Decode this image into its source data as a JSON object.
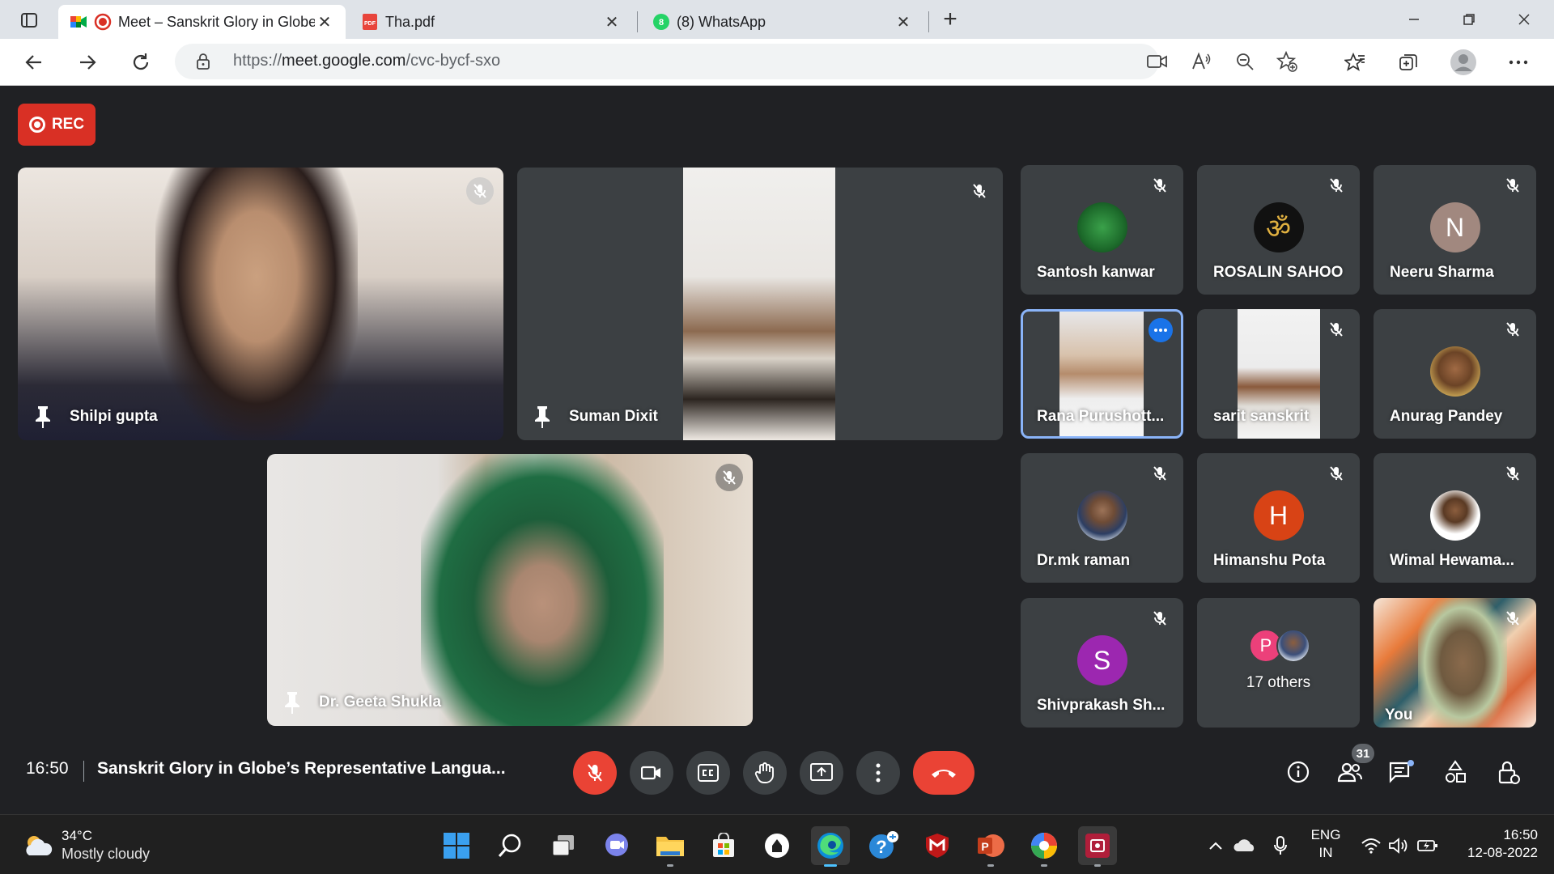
{
  "browser": {
    "tabs": [
      {
        "title": "Meet – Sanskrit Glory in Globe's Representative Languages",
        "active": true
      },
      {
        "title": "Tha.pdf",
        "active": false
      },
      {
        "title": "(8) WhatsApp",
        "active": false,
        "badge": "8"
      }
    ],
    "url_scheme": "https://",
    "url_host": "meet.google.com",
    "url_path": "/cvc-bycf-sxo"
  },
  "meet": {
    "rec_label": "REC",
    "main_tiles": [
      {
        "name": "Shilpi gupta"
      },
      {
        "name": "Suman Dixit"
      },
      {
        "name": "Dr. Geeta Shukla"
      }
    ],
    "small_tiles": [
      {
        "name": "Santosh kanwar"
      },
      {
        "name": "ROSALIN SAHOO"
      },
      {
        "name": "Neeru Sharma",
        "initial": "N",
        "color": "#a1887f"
      },
      {
        "name": "Rana Purushott..."
      },
      {
        "name": "sarit sanskrit"
      },
      {
        "name": "Anurag Pandey"
      },
      {
        "name": "Dr.mk raman"
      },
      {
        "name": "Himanshu Pota",
        "initial": "H",
        "color": "#d84315"
      },
      {
        "name": "Wimal Hewama..."
      },
      {
        "name": "Shivprakash Sh...",
        "initial": "S",
        "color": "#9c27b0"
      },
      {
        "name": "17 others",
        "initial": "P",
        "color": "#ec407a"
      },
      {
        "name": "You"
      }
    ],
    "bar": {
      "time": "16:50",
      "meeting_title": "Sanskrit Glory in Globe’s Representative Langua...",
      "people_count": "31"
    }
  },
  "taskbar": {
    "weather_temp": "34°C",
    "weather_cond": "Mostly cloudy",
    "lang_1": "ENG",
    "lang_2": "IN",
    "time": "16:50",
    "date": "12-08-2022"
  },
  "colors": {
    "rec": "#d93025",
    "mute_active": "#ea4335",
    "speaking_border": "#8ab4f8",
    "meet_bg": "#202124",
    "tile_bg": "#3c4043"
  }
}
